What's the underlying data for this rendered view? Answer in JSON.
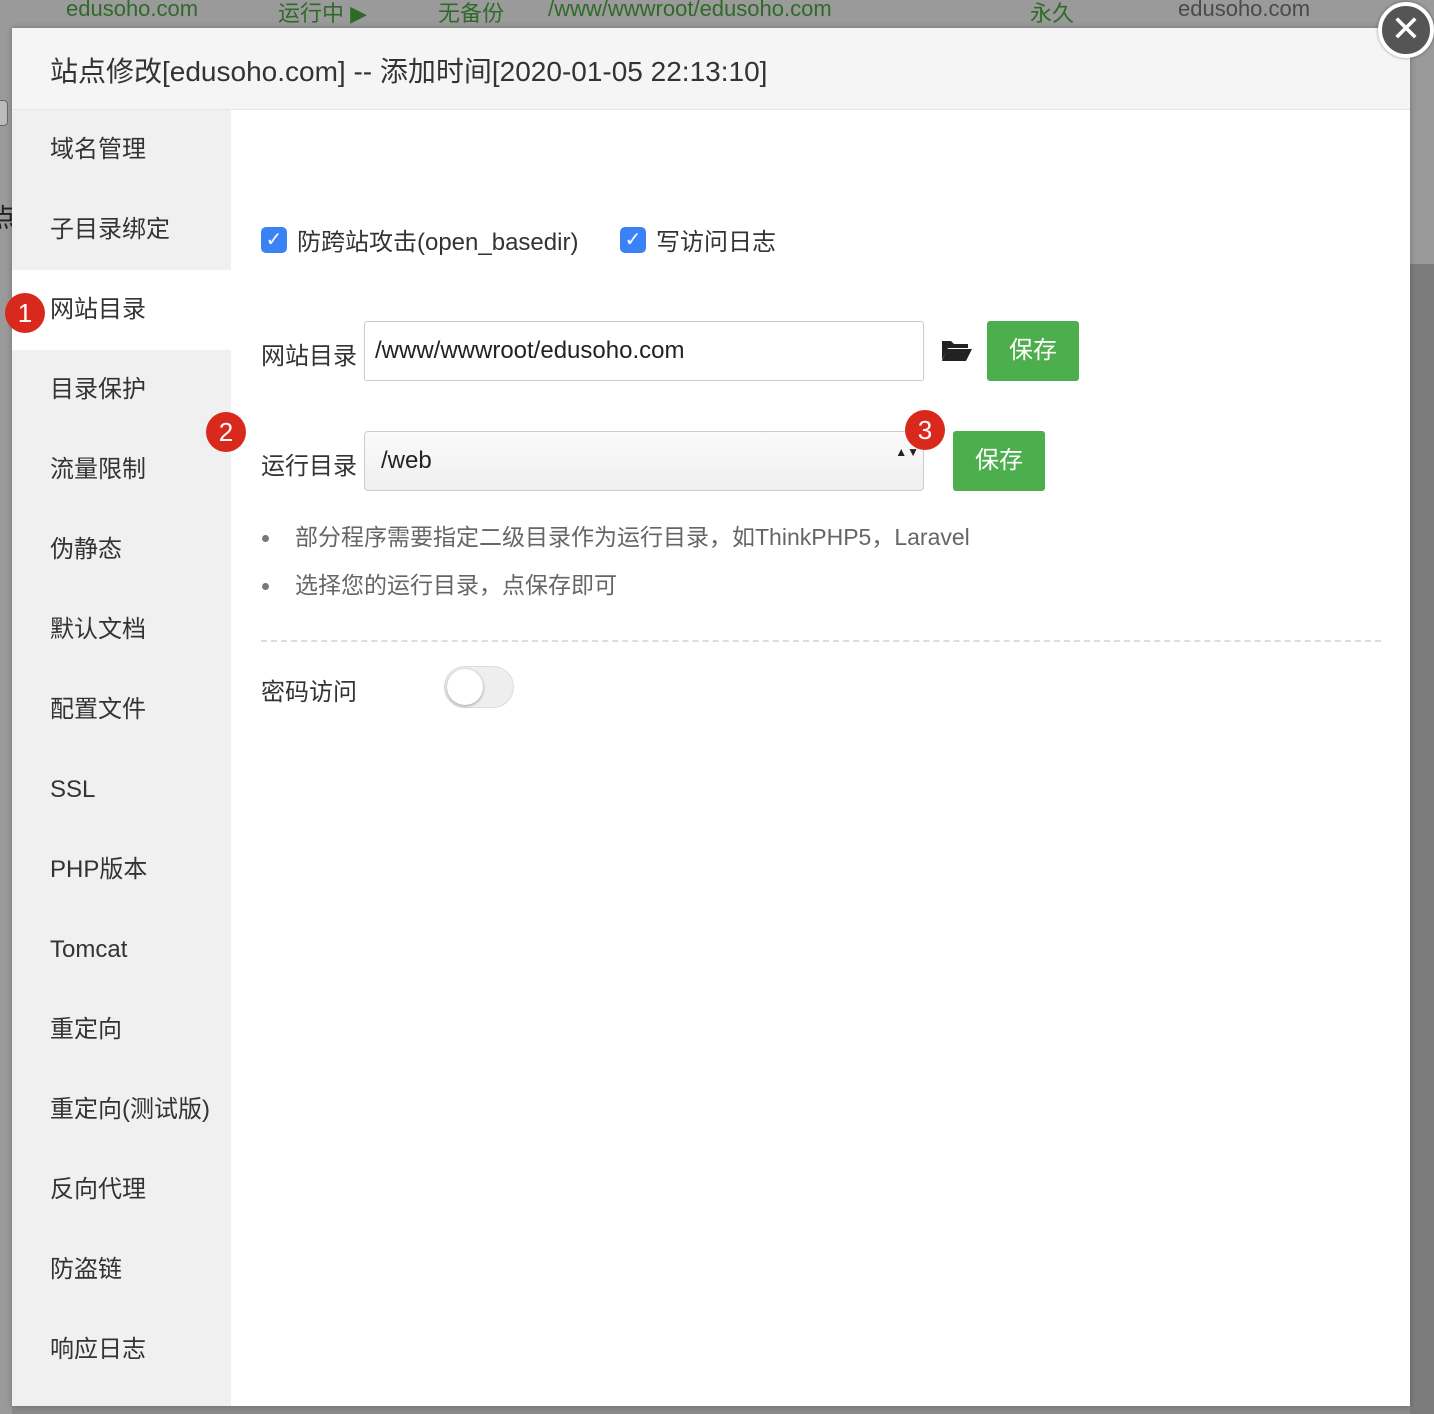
{
  "background": {
    "row": [
      "edusoho.com",
      "运行中 ▶",
      "无备份",
      "/www/wwwroot/edusoho.com",
      "永久",
      "edusoho.com"
    ],
    "left_char": "点"
  },
  "dialog": {
    "title": "站点修改[edusoho.com] -- 添加时间[2020-01-05 22:13:10]",
    "close_glyph": "✕"
  },
  "sidebar": {
    "items": [
      {
        "label": "域名管理"
      },
      {
        "label": "子目录绑定"
      },
      {
        "label": "网站目录",
        "active": true
      },
      {
        "label": "目录保护"
      },
      {
        "label": "流量限制"
      },
      {
        "label": "伪静态"
      },
      {
        "label": "默认文档"
      },
      {
        "label": "配置文件"
      },
      {
        "label": "SSL"
      },
      {
        "label": "PHP版本"
      },
      {
        "label": "Tomcat"
      },
      {
        "label": "重定向"
      },
      {
        "label": "重定向(测试版)"
      },
      {
        "label": "反向代理"
      },
      {
        "label": "防盗链"
      },
      {
        "label": "响应日志"
      }
    ]
  },
  "badges": {
    "one": "1",
    "two": "2",
    "three": "3"
  },
  "options": {
    "open_basedir": {
      "label": "防跨站攻击(open_basedir)",
      "checked": true,
      "check_glyph": "✓"
    },
    "access_log": {
      "label": "写访问日志",
      "checked": true,
      "check_glyph": "✓"
    }
  },
  "site_dir": {
    "label": "网站目录",
    "value": "/www/wwwroot/edusoho.com",
    "save_label": "保存"
  },
  "run_dir": {
    "label": "运行目录",
    "selected": "/web",
    "arrows": "▲▼",
    "save_label": "保存"
  },
  "tips": [
    "部分程序需要指定二级目录作为运行目录，如ThinkPHP5，Laravel",
    "选择您的运行目录，点保存即可"
  ],
  "password_access": {
    "label": "密码访问",
    "enabled": false
  },
  "colors": {
    "accent_green": "#4cae4c",
    "checkbox_blue": "#3b82f6",
    "badge_red": "#d9291c"
  }
}
